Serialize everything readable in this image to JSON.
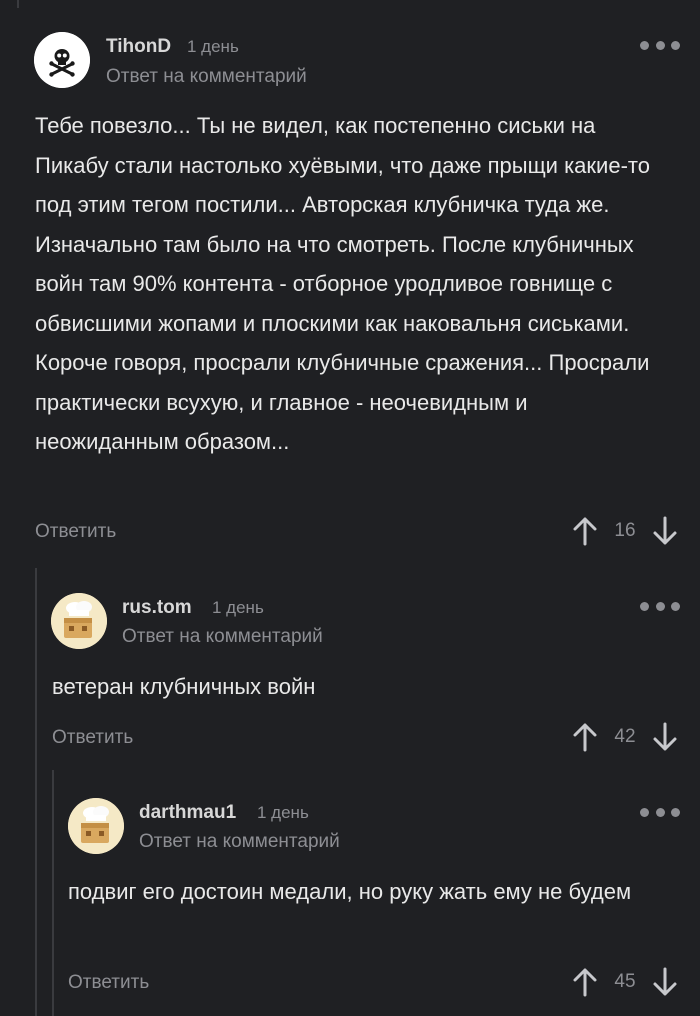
{
  "comments": [
    {
      "author": "TihonD",
      "time": "1 день",
      "reply_to": "Ответ на комментарий",
      "text": "Тебе повезло... Ты не видел, как постепенно сиськи на Пикабу стали настолько хуёвыми, что даже прыщи какие-то под этим тегом постили... Авторская клубничка туда же. Изначально там было на что смотреть. После клубничных войн там 90% контента - отборное уродливое говнище с обвисшими жопами и плоскими как наковальня сиськами. Короче говоря, просрали клубничные сражения... Просрали практически всухую, и главное - неочевидным и неожиданным образом...",
      "reply_label": "Ответить",
      "rating": "16",
      "avatar_icon": "skull-crossbones-icon"
    },
    {
      "author": "rus.tom",
      "time": "1 день",
      "reply_to": "Ответ на комментарий",
      "text": "ветеран клубничных войн",
      "reply_label": "Ответить",
      "rating": "42",
      "avatar_icon": "chef-box-icon"
    },
    {
      "author": "darthmau1",
      "time": "1 день",
      "reply_to": "Ответ на комментарий",
      "text": "подвиг его достоин медали, но руку жать ему не будем",
      "reply_label": "Ответить",
      "rating": "45",
      "avatar_icon": "chef-box-icon"
    }
  ],
  "colors": {
    "background": "#1f2023",
    "text": "#e9e9e9",
    "muted": "#8d8e93",
    "thread_line": "#3a3b3f"
  }
}
